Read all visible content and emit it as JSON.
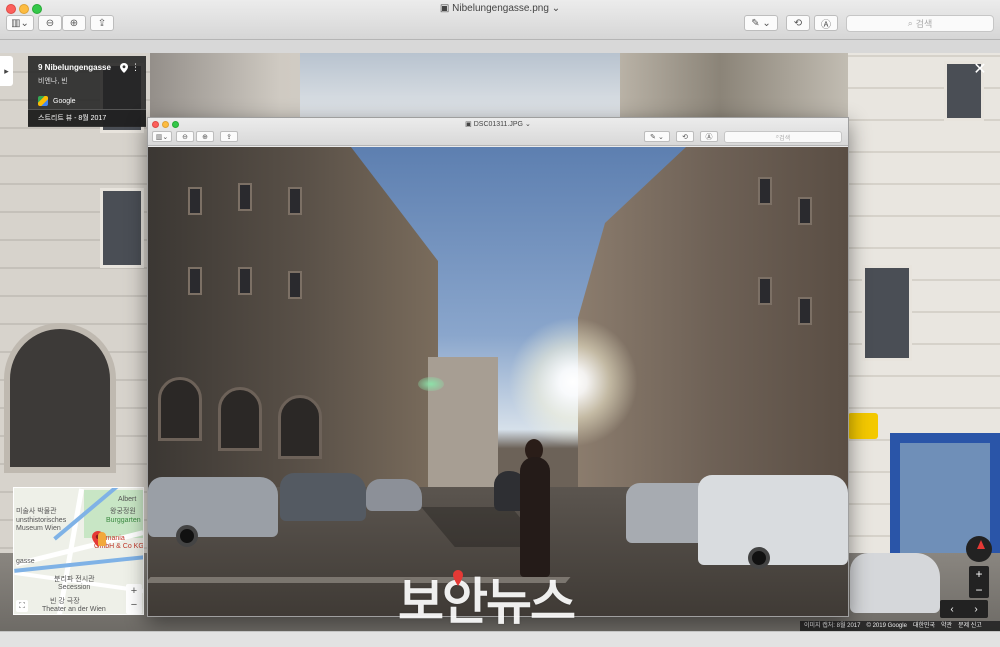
{
  "window": {
    "title": "Nibelungengasse.png",
    "search_placeholder": "검색"
  },
  "inner_window": {
    "title": "DSC01311.JPG",
    "search_placeholder": "검색"
  },
  "street_view": {
    "place_name": "9 Nibelungengasse",
    "place_sub": "비엔나, 빈",
    "provider": "Google",
    "date_label": "스트리트 뷰 - 8월 2017",
    "footer": {
      "capture": "이미지 캡처: 8월 2017",
      "copyright": "© 2019 Google",
      "country": "대한민국",
      "terms": "약관",
      "report": "문제 신고"
    }
  },
  "minimap": {
    "labels": {
      "albertina": "Albert",
      "palace_garden": "왕궁정원",
      "burggarten": "Burggarten",
      "kunst_museum": "미술사 박물관",
      "kunsthist": "unsthistorisches",
      "museum_wien": "Museum Wien",
      "poi_name": "Germania",
      "poi_sub": "GmbH & Co KG",
      "secession": "분리파 전시관",
      "secession_en": "Secession",
      "theater_kr": "빈 강 극장",
      "theater_en": "Theater an der Wien",
      "gasse": "gasse"
    }
  },
  "watermark": {
    "text": "보안뉴스"
  },
  "colors": {
    "accent_red": "#e53935",
    "traffic_red": "#fc605c",
    "traffic_yellow": "#fdbc40",
    "traffic_green": "#34c84a",
    "shop_blue": "#2a55a8",
    "sign_yellow": "#f4c900"
  },
  "icons": {
    "sidebar_toggle": "sidebar-icon",
    "zoom_out": "zoom-out-icon",
    "zoom_in": "zoom-in-icon",
    "share": "share-icon",
    "markup": "markup-pen-icon",
    "rotate": "rotate-icon",
    "annotate": "annotate-icon",
    "search": "search-icon"
  }
}
